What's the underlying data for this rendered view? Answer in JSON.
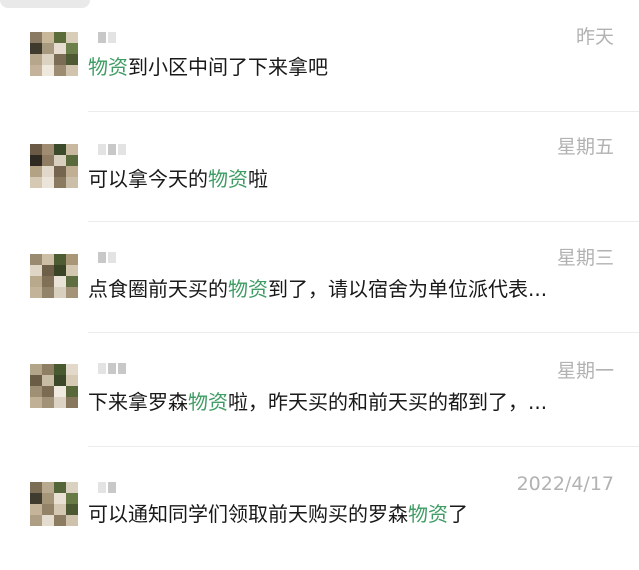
{
  "chats": [
    {
      "time": "昨天",
      "pre": "",
      "kw": "物资",
      "post": "到小区中间了下来拿吧"
    },
    {
      "time": "星期五",
      "pre": "可以拿今天的",
      "kw": "物资",
      "post": "啦"
    },
    {
      "time": "星期三",
      "pre": "点食圈前天买的",
      "kw": "物资",
      "post": "到了，请以宿舍为单位派代表..."
    },
    {
      "time": "星期一",
      "pre": "下来拿罗森",
      "kw": "物资",
      "post": "啦，昨天买的和前天买的都到了，..."
    },
    {
      "time": "2022/4/17",
      "pre": "可以通知同学们领取前天购买的罗森",
      "kw": "物资",
      "post": "了"
    }
  ],
  "colors": {
    "keyword": "#3f9c64",
    "text": "#191919",
    "time": "#b2b2b2"
  }
}
